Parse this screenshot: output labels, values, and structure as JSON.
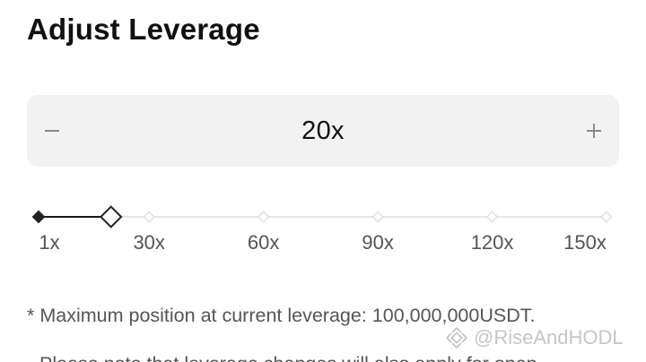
{
  "header": {
    "title": "Adjust Leverage"
  },
  "stepper": {
    "decrement_icon": "minus-icon",
    "increment_icon": "plus-icon",
    "value": "20x"
  },
  "slider": {
    "min": 1,
    "max": 150,
    "current": 20,
    "ticks": [
      "1x",
      "30x",
      "60x",
      "90x",
      "120x",
      "150x"
    ],
    "active_color": "#1a1a1a",
    "inactive_color": "#e6e6e6"
  },
  "notes": {
    "max_position": "* Maximum position at current leverage: 100,000,000USDT.",
    "partial_line": "Please note that leverage changes will also apply for open"
  },
  "watermark": {
    "text": "@RiseAndHODL",
    "icon": "binance-logo-icon"
  }
}
